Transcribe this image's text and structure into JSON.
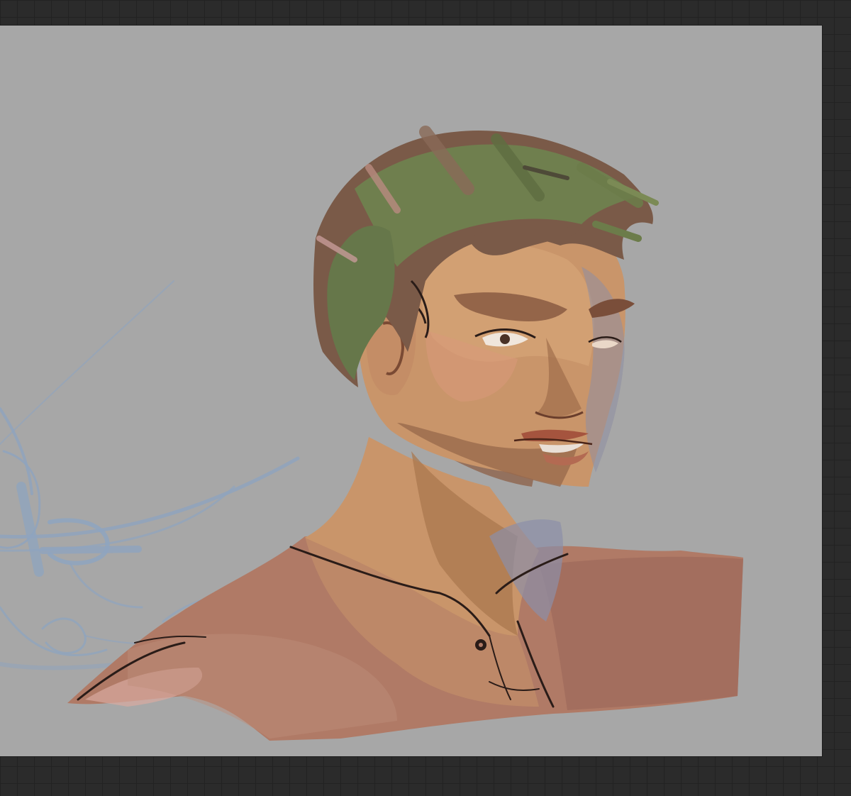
{
  "workspace": {
    "background": "#2b2b2b",
    "grid_color": "#222222"
  },
  "canvas": {
    "background": "#a7a7a7"
  },
  "artwork": {
    "subject": "painted-portrait-bust",
    "colors": {
      "skin": "#c9956a",
      "skin_shadow": "#9a6a4c",
      "hair": "#6f7f4e",
      "hair_dark": "#7a5a48",
      "shirt": "#b07a66",
      "sketch_lines": "#8ea4bf",
      "line_art": "#2a1c18"
    }
  }
}
